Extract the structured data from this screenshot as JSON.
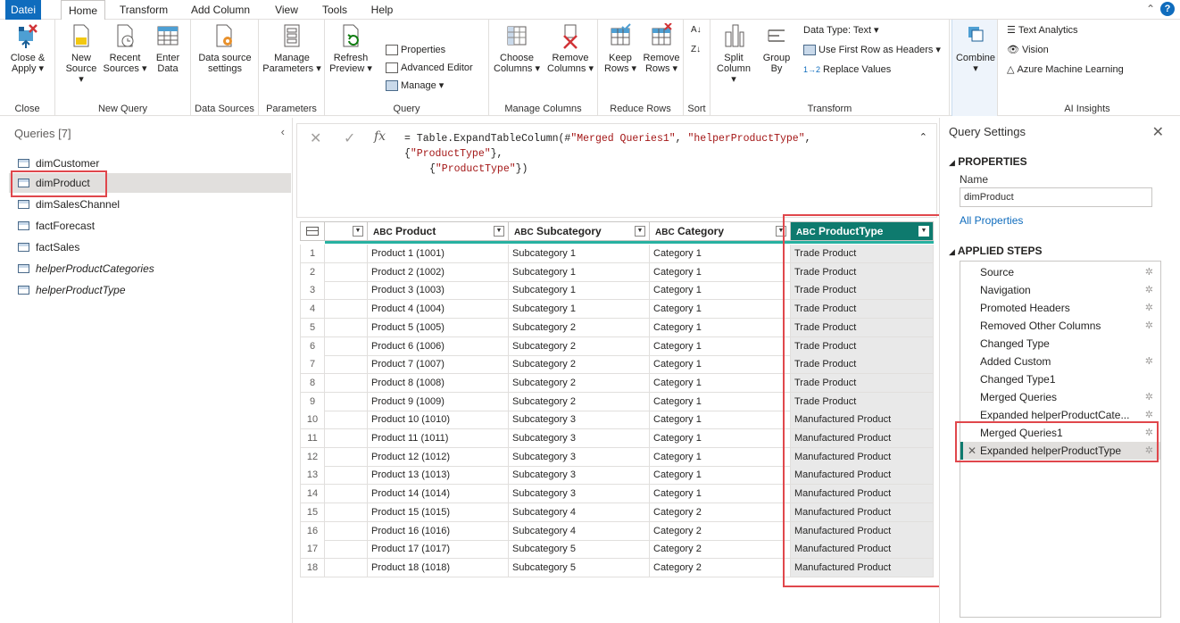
{
  "tabs": [
    {
      "label": "Datei"
    },
    {
      "label": "Home"
    },
    {
      "label": "Transform"
    },
    {
      "label": "Add Column"
    },
    {
      "label": "View"
    },
    {
      "label": "Tools"
    },
    {
      "label": "Help"
    }
  ],
  "ribbon": {
    "close": {
      "btn1": "Close &",
      "btn2": "Apply",
      "group": "Close"
    },
    "new_query": {
      "new1": "New",
      "new2": "Source",
      "recent1": "Recent",
      "recent2": "Sources",
      "enter1": "Enter",
      "enter2": "Data",
      "group": "New Query"
    },
    "data_sources": {
      "btn1": "Data source",
      "btn2": "settings",
      "group": "Data Sources"
    },
    "parameters": {
      "btn1": "Manage",
      "btn2": "Parameters",
      "group": "Parameters"
    },
    "query": {
      "refresh1": "Refresh",
      "refresh2": "Preview",
      "properties": "Properties",
      "advanced": "Advanced Editor",
      "manage": "Manage",
      "group": "Query"
    },
    "manage_columns": {
      "choose1": "Choose",
      "choose2": "Columns",
      "remove1": "Remove",
      "remove2": "Columns",
      "group": "Manage Columns"
    },
    "reduce_rows": {
      "keep1": "Keep",
      "keep2": "Rows",
      "remove1": "Remove",
      "remove2": "Rows",
      "group": "Reduce Rows"
    },
    "sort": {
      "group": "Sort"
    },
    "transform": {
      "split1": "Split",
      "split2": "Column",
      "group1": "Group",
      "group2": "By",
      "datatype": "Data Type: Text",
      "firstrow": "Use First Row as Headers",
      "replace": "Replace Values",
      "group": "Transform"
    },
    "combine": {
      "btn": "Combine"
    },
    "ai": {
      "text": "Text Analytics",
      "vision": "Vision",
      "aml": "Azure Machine Learning",
      "group": "AI Insights"
    }
  },
  "queries": {
    "title": "Queries [7]",
    "items": [
      {
        "label": "dimCustomer"
      },
      {
        "label": "dimProduct"
      },
      {
        "label": "dimSalesChannel"
      },
      {
        "label": "factForecast"
      },
      {
        "label": "factSales"
      },
      {
        "label": "helperProductCategories"
      },
      {
        "label": "helperProductType"
      }
    ]
  },
  "formula": {
    "fx": "fx",
    "p1": "= Table.ExpandTableColumn(#",
    "s1": "\"Merged Queries1\"",
    "p2": ", ",
    "s2": "\"helperProductType\"",
    "p3": ", {",
    "s3": "\"ProductType\"",
    "p4": "},",
    "l2p": "{",
    "l2s": "\"ProductType\"",
    "l2e": "})"
  },
  "grid": {
    "abc": "ABC",
    "columns": [
      "Product",
      "Subcategory",
      "Category",
      "ProductType"
    ],
    "rows": [
      [
        "1",
        "Product 1 (1001)",
        "Subcategory 1",
        "Category 1",
        "Trade Product"
      ],
      [
        "2",
        "Product 2 (1002)",
        "Subcategory 1",
        "Category 1",
        "Trade Product"
      ],
      [
        "3",
        "Product 3 (1003)",
        "Subcategory 1",
        "Category 1",
        "Trade Product"
      ],
      [
        "4",
        "Product 4 (1004)",
        "Subcategory 1",
        "Category 1",
        "Trade Product"
      ],
      [
        "5",
        "Product 5 (1005)",
        "Subcategory 2",
        "Category 1",
        "Trade Product"
      ],
      [
        "6",
        "Product 6 (1006)",
        "Subcategory 2",
        "Category 1",
        "Trade Product"
      ],
      [
        "7",
        "Product 7 (1007)",
        "Subcategory 2",
        "Category 1",
        "Trade Product"
      ],
      [
        "8",
        "Product 8 (1008)",
        "Subcategory 2",
        "Category 1",
        "Trade Product"
      ],
      [
        "9",
        "Product 9 (1009)",
        "Subcategory 2",
        "Category 1",
        "Trade Product"
      ],
      [
        "10",
        "Product 10 (1010)",
        "Subcategory 3",
        "Category 1",
        "Manufactured Product"
      ],
      [
        "11",
        "Product 11 (1011)",
        "Subcategory 3",
        "Category 1",
        "Manufactured Product"
      ],
      [
        "12",
        "Product 12 (1012)",
        "Subcategory 3",
        "Category 1",
        "Manufactured Product"
      ],
      [
        "13",
        "Product 13 (1013)",
        "Subcategory 3",
        "Category 1",
        "Manufactured Product"
      ],
      [
        "14",
        "Product 14 (1014)",
        "Subcategory 3",
        "Category 1",
        "Manufactured Product"
      ],
      [
        "15",
        "Product 15 (1015)",
        "Subcategory 4",
        "Category 2",
        "Manufactured Product"
      ],
      [
        "16",
        "Product 16 (1016)",
        "Subcategory 4",
        "Category 2",
        "Manufactured Product"
      ],
      [
        "17",
        "Product 17 (1017)",
        "Subcategory 5",
        "Category 2",
        "Manufactured Product"
      ],
      [
        "18",
        "Product 18 (1018)",
        "Subcategory 5",
        "Category 2",
        "Manufactured Product"
      ]
    ]
  },
  "settings": {
    "title": "Query Settings",
    "properties": "PROPERTIES",
    "name_label": "Name",
    "name_value": "dimProduct",
    "all_properties": "All Properties",
    "applied_steps": "APPLIED STEPS",
    "steps": [
      {
        "label": "Source"
      },
      {
        "label": "Navigation"
      },
      {
        "label": "Promoted Headers"
      },
      {
        "label": "Removed Other Columns"
      },
      {
        "label": "Changed Type"
      },
      {
        "label": "Added Custom"
      },
      {
        "label": "Changed Type1"
      },
      {
        "label": "Merged Queries"
      },
      {
        "label": "Expanded helperProductCate..."
      },
      {
        "label": "Merged Queries1"
      },
      {
        "label": "Expanded helperProductType"
      }
    ]
  },
  "colors": {
    "accent": "#0f6cbd",
    "teal": "#0e7a6e",
    "highlight": "#e0474c"
  }
}
